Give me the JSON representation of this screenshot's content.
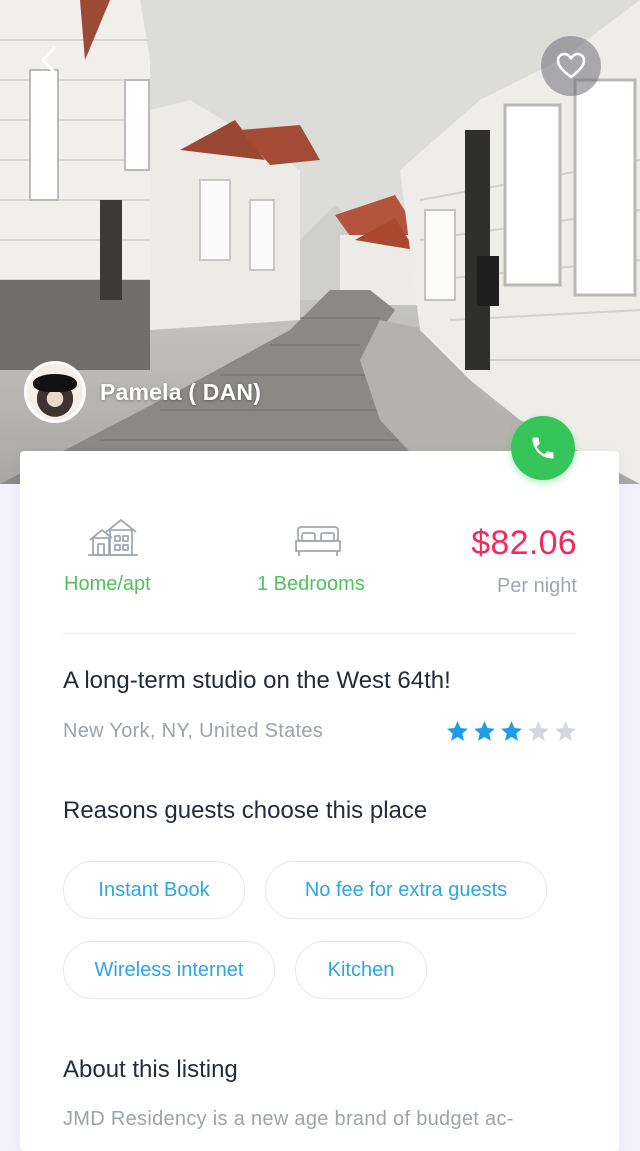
{
  "host": {
    "name": "Pamela ( DAN)"
  },
  "icons": {
    "back": "chevron-left-icon",
    "favorite": "heart-icon",
    "call": "phone-icon",
    "property_type": "house-icon",
    "bedrooms": "bed-icon",
    "rating": "star-icon"
  },
  "listing": {
    "type": "Home/apt",
    "bedrooms": "1 Bedrooms",
    "price": "$82.06",
    "price_unit": "Per night",
    "title": "A long-term studio on the West 64th!",
    "location": "New York, NY, United States",
    "rating": 3,
    "rating_max": 5
  },
  "reasons": {
    "title": "Reasons guests choose this place",
    "items": [
      "Instant Book",
      "No fee for extra guests",
      "Wireless internet",
      "Kitchen"
    ]
  },
  "about": {
    "title": "About this listing",
    "text": "JMD Residency is a new age brand of budget ac-"
  },
  "colors": {
    "accent_green": "#4fc25e",
    "call_green": "#35c55a",
    "price_pink": "#f5295e",
    "pill_blue": "#2aa6e6",
    "star_blue": "#1e9ee8",
    "star_empty": "#d5d8de",
    "muted_text": "#9da2ab",
    "page_background": "#f3f1fb"
  }
}
